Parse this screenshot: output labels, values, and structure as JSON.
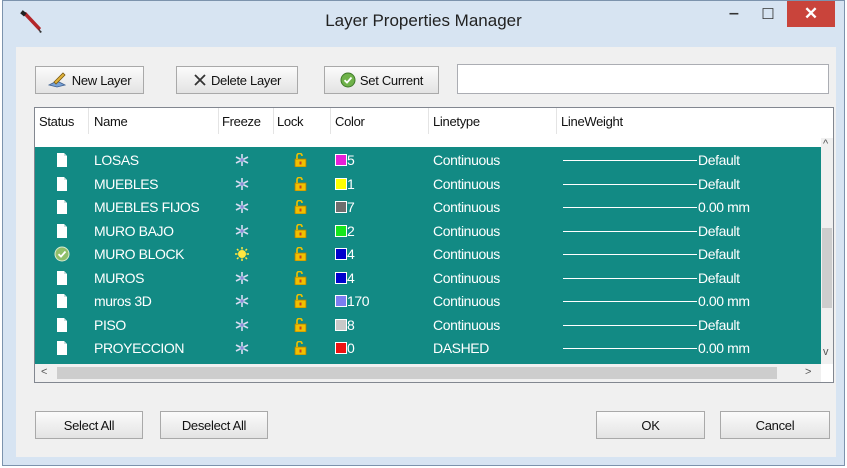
{
  "window": {
    "title": "Layer Properties Manager",
    "minimize_glyph": "‒",
    "maximize_glyph": "☐",
    "close_glyph": "✕"
  },
  "toolbar": {
    "new_layer": "New Layer",
    "delete_layer": "Delete Layer",
    "set_current": "Set Current",
    "text_value": ""
  },
  "columns": [
    "Status",
    "Name",
    "Freeze",
    "Lock",
    "Color",
    "Linetype",
    "LineWeight"
  ],
  "layers": [
    {
      "status": "document",
      "name": "LOSAS",
      "freeze": "thawed",
      "lock": "unlocked",
      "color_hex": "#e81fd8",
      "color_label": "5",
      "linetype": "Continuous",
      "lineweight": "Default"
    },
    {
      "status": "document",
      "name": "MUEBLES",
      "freeze": "thawed",
      "lock": "unlocked",
      "color_hex": "#ffff00",
      "color_label": "1",
      "linetype": "Continuous",
      "lineweight": "Default"
    },
    {
      "status": "document",
      "name": "MUEBLES FIJOS",
      "freeze": "thawed",
      "lock": "unlocked",
      "color_hex": "#6e6e6e",
      "color_label": "7",
      "linetype": "Continuous",
      "lineweight": "0.00 mm"
    },
    {
      "status": "document",
      "name": "MURO BAJO",
      "freeze": "thawed",
      "lock": "unlocked",
      "color_hex": "#16e61b",
      "color_label": "2",
      "linetype": "Continuous",
      "lineweight": "Default"
    },
    {
      "status": "current",
      "name": "MURO BLOCK",
      "freeze": "sun",
      "lock": "unlocked",
      "color_hex": "#0000cc",
      "color_label": "4",
      "linetype": "Continuous",
      "lineweight": "Default"
    },
    {
      "status": "document",
      "name": "MUROS",
      "freeze": "thawed",
      "lock": "unlocked",
      "color_hex": "#0000cc",
      "color_label": "4",
      "linetype": "Continuous",
      "lineweight": "Default"
    },
    {
      "status": "document",
      "name": "muros 3D",
      "freeze": "thawed",
      "lock": "unlocked",
      "color_hex": "#7d7df0",
      "color_label": "170",
      "linetype": "Continuous",
      "lineweight": "0.00 mm"
    },
    {
      "status": "document",
      "name": "PISO",
      "freeze": "thawed",
      "lock": "unlocked",
      "color_hex": "#c8c8c8",
      "color_label": "8",
      "linetype": "Continuous",
      "lineweight": "Default"
    },
    {
      "status": "document",
      "name": "PROYECCION",
      "freeze": "thawed",
      "lock": "unlocked",
      "color_hex": "#ee1111",
      "color_label": "0",
      "linetype": "DASHED",
      "lineweight": "0.00 mm"
    }
  ],
  "footer": {
    "select_all": "Select All",
    "deselect_all": "Deselect All",
    "ok": "OK",
    "cancel": "Cancel"
  },
  "scroll": {
    "up": "^",
    "down": "v",
    "left": "<",
    "right": ">"
  },
  "colors": {
    "selection": "#128a84",
    "close_button": "#c9443b",
    "window_frame": "#d7e4f2"
  }
}
